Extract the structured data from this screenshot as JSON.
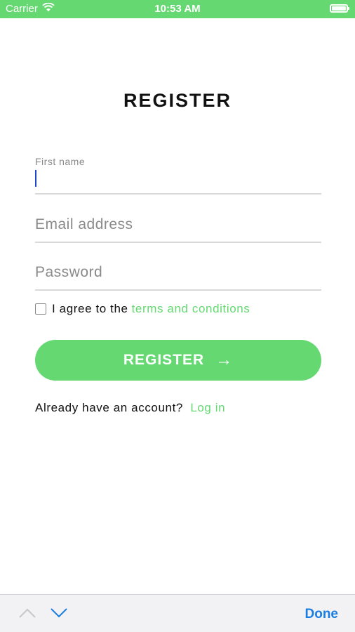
{
  "status_bar": {
    "carrier": "Carrier",
    "time": "10:53 AM",
    "background": "#65d872"
  },
  "header": {
    "title": "REGISTER"
  },
  "form": {
    "first_name": {
      "label": "First name",
      "value": ""
    },
    "email": {
      "placeholder": "Email address",
      "value": ""
    },
    "password": {
      "placeholder": "Password",
      "value": ""
    },
    "agree": {
      "prefix": "I agree to the",
      "link": "terms and conditions",
      "checked": false
    },
    "register_button": {
      "label": "REGISTER",
      "icon": "arrow-right-icon",
      "arrow": "→"
    },
    "login_prompt": {
      "text": "Already have an account?",
      "link": "Log in"
    }
  },
  "keyboard_toolbar": {
    "previous_icon": "chevron-up-icon",
    "next_icon": "chevron-down-icon",
    "done_label": "Done"
  },
  "colors": {
    "accent": "#65d872",
    "caret": "#1a48c9",
    "done": "#1a7de0"
  }
}
